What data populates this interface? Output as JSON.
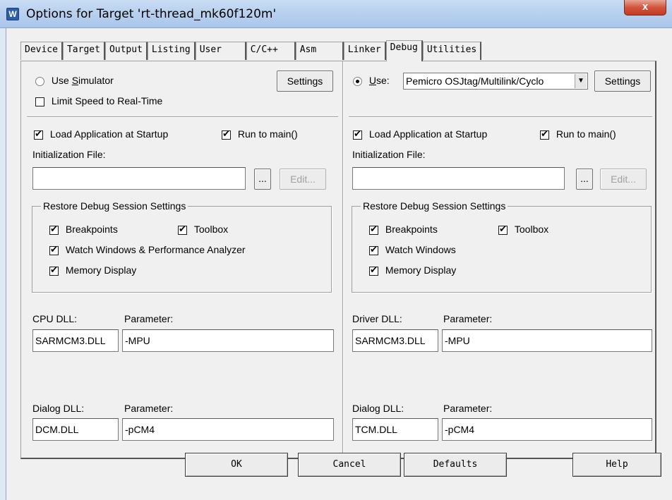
{
  "window": {
    "title": "Options for Target 'rt-thread_mk60f120m'",
    "close_label": "x"
  },
  "tabs": [
    {
      "label": "Device"
    },
    {
      "label": "Target"
    },
    {
      "label": "Output"
    },
    {
      "label": "Listing"
    },
    {
      "label": "User"
    },
    {
      "label": "C/C++"
    },
    {
      "label": "Asm"
    },
    {
      "label": "Linker"
    },
    {
      "label": "Debug",
      "active": true
    },
    {
      "label": "Utilities"
    }
  ],
  "left": {
    "use_simulator_label_pre": "Use ",
    "use_simulator_label_ul": "S",
    "use_simulator_label_post": "imulator",
    "use_simulator_selected": false,
    "settings_label": "Settings",
    "limit_speed_label": "Limit Speed to Real-Time",
    "limit_speed_checked": false,
    "load_app_label": "Load Application at Startup",
    "load_app_checked": true,
    "run_to_main_label": "Run to main()",
    "run_to_main_checked": true,
    "init_file_label": "Initialization File:",
    "init_file_value": "",
    "browse_label": "...",
    "edit_label": "Edit...",
    "restore_group_label": "Restore Debug Session Settings",
    "breakpoints_label": "Breakpoints",
    "toolbox_label": "Toolbox",
    "watch_label": "Watch Windows & Performance Analyzer",
    "memory_label": "Memory Display",
    "cpu_dll_label": "CPU DLL:",
    "cpu_dll_value": "SARMCM3.DLL",
    "cpu_param_label": "Parameter:",
    "cpu_param_value": "-MPU",
    "dialog_dll_label": "Dialog DLL:",
    "dialog_dll_value": "DCM.DLL",
    "dialog_param_label": "Parameter:",
    "dialog_param_value": "-pCM4"
  },
  "right": {
    "use_label_ul": "U",
    "use_label_post": "se:",
    "use_selected": true,
    "debugger_value": "Pemicro OSJtag/Multilink/Cyclo",
    "settings_label": "Settings",
    "load_app_label": "Load Application at Startup",
    "load_app_checked": true,
    "run_to_main_label": "Run to main()",
    "run_to_main_checked": true,
    "init_file_label": "Initialization File:",
    "init_file_value": "",
    "browse_label": "...",
    "edit_label": "Edit...",
    "restore_group_label": "Restore Debug Session Settings",
    "breakpoints_label": "Breakpoints",
    "toolbox_label": "Toolbox",
    "watch_label": "Watch Windows",
    "memory_label": "Memory Display",
    "driver_dll_label": "Driver DLL:",
    "driver_dll_value": "SARMCM3.DLL",
    "driver_param_label": "Parameter:",
    "driver_param_value": "-MPU",
    "dialog_dll_label": "Dialog DLL:",
    "dialog_dll_value": "TCM.DLL",
    "dialog_param_label": "Parameter:",
    "dialog_param_value": "-pCM4"
  },
  "buttons": {
    "ok": "OK",
    "cancel": "Cancel",
    "defaults": "Defaults",
    "help": "Help"
  }
}
